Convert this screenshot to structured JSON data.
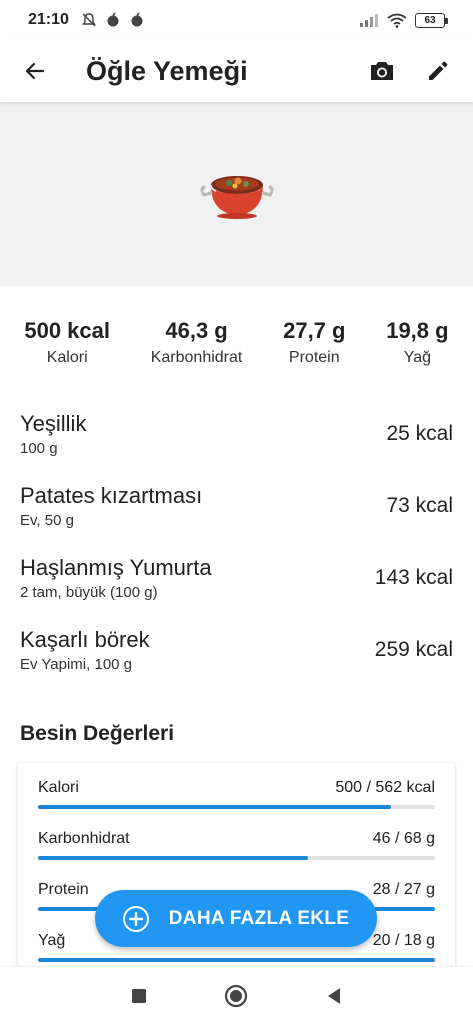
{
  "status_bar": {
    "time": "21:10",
    "battery": "63"
  },
  "app_bar": {
    "title": "Öğle Yemeği"
  },
  "macros": [
    {
      "value": "500 kcal",
      "label": "Kalori"
    },
    {
      "value": "46,3 g",
      "label": "Karbonhidrat"
    },
    {
      "value": "27,7 g",
      "label": "Protein"
    },
    {
      "value": "19,8 g",
      "label": "Yağ"
    }
  ],
  "foods": [
    {
      "name": "Yeşillik",
      "amount": "100 g",
      "kcal": "25 kcal"
    },
    {
      "name": "Patates kızartması",
      "amount": "Ev, 50 g",
      "kcal": "73 kcal"
    },
    {
      "name": "Haşlanmış Yumurta",
      "amount": "2 tam, büyük (100 g)",
      "kcal": "143 kcal"
    },
    {
      "name": "Kaşarlı börek",
      "amount": "Ev Yapimi, 100 g",
      "kcal": "259 kcal"
    }
  ],
  "nutrition": {
    "title": "Besin Değerleri",
    "rows": [
      {
        "label": "Kalori",
        "value": "500 / 562 kcal",
        "progress": 0.89
      },
      {
        "label": "Karbonhidrat",
        "value": "46 / 68 g",
        "progress": 0.68
      },
      {
        "label": "Protein",
        "value": "28 / 27 g",
        "progress": 1.0
      },
      {
        "label": "Yağ",
        "value": "20 / 18 g",
        "progress": 1.0
      }
    ]
  },
  "fab": {
    "label": "DAHA FAZLA EKLE"
  },
  "colors": {
    "accent": "#2196f3",
    "progress": "#1a88d6",
    "hero_bg": "#f1f1f1"
  },
  "icons": {
    "back": "arrow-left-icon",
    "camera": "camera-icon",
    "edit": "pencil-icon",
    "hero": "cooking-pot-icon"
  }
}
